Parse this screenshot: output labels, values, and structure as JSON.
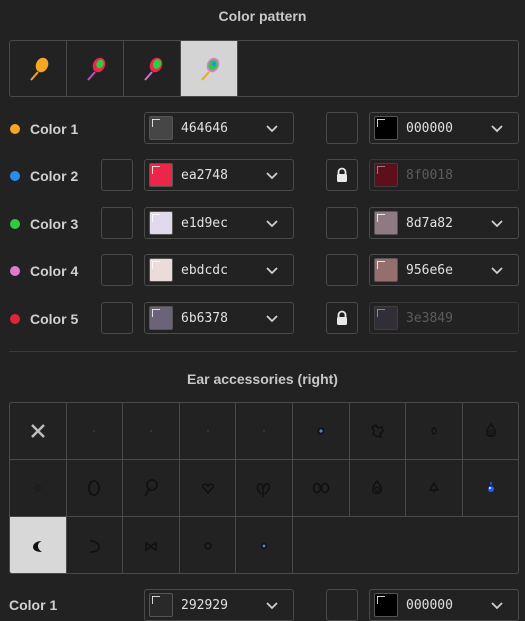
{
  "color_pattern": {
    "title": "Color pattern",
    "tiles": [
      {
        "icon": "balloon-orange-icon",
        "selected": false
      },
      {
        "icon": "balloon-red-green-icon",
        "selected": false
      },
      {
        "icon": "balloon-red-green-icon",
        "selected": false
      },
      {
        "icon": "balloon-pink-green-icon",
        "selected": true
      }
    ]
  },
  "colors": [
    {
      "label": "Color 1",
      "dot": "#f5a623",
      "primary_hex": "464646",
      "primary_color": "#464646",
      "primary_disabled": false,
      "secondary_hex": "000000",
      "secondary_color": "#000000",
      "secondary_disabled": false,
      "show_left_box": false,
      "locked": false
    },
    {
      "label": "Color 2",
      "dot": "#2a8cf0",
      "primary_hex": "ea2748",
      "primary_color": "#ea2748",
      "primary_disabled": false,
      "secondary_hex": "8f0018",
      "secondary_color": "#8f0018",
      "secondary_disabled": true,
      "show_left_box": true,
      "locked": true
    },
    {
      "label": "Color 3",
      "dot": "#2ecc40",
      "primary_hex": "e1d9ec",
      "primary_color": "#e1d9ec",
      "primary_disabled": false,
      "secondary_hex": "8d7a82",
      "secondary_color": "#8d7a82",
      "secondary_disabled": false,
      "show_left_box": true,
      "locked": false
    },
    {
      "label": "Color 4",
      "dot": "#e07ad0",
      "primary_hex": "ebdcdc",
      "primary_color": "#ebdcdc",
      "primary_disabled": false,
      "secondary_hex": "956e6e",
      "secondary_color": "#956e6e",
      "secondary_disabled": false,
      "show_left_box": true,
      "locked": false
    },
    {
      "label": "Color 5",
      "dot": "#e0243c",
      "primary_hex": "6b6378",
      "primary_color": "#6b6378",
      "primary_disabled": false,
      "secondary_hex": "3e3849",
      "secondary_color": "#3e3849",
      "secondary_disabled": true,
      "show_left_box": true,
      "locked": true
    }
  ],
  "ear_accessories": {
    "title": "Ear accessories (right)",
    "items": [
      "none-x-icon",
      "tiny-dot-icon",
      "tiny-dot-icon",
      "tiny-dot-icon",
      "tiny-dot-icon",
      "dark-gem-icon",
      "flower-icon",
      "small-ring-icon",
      "drop-ring-icon",
      "small-diamond-icon",
      "large-ring-icon",
      "loop-pendant-icon",
      "heart-icon",
      "double-heart-icon",
      "double-ring-icon",
      "drop-ring-icon",
      "spade-pendant-icon",
      "blue-gem-icon",
      "crescent-icon",
      "crescent-open-icon",
      "bow-icon",
      "tiny-ring-icon",
      "blue-stud-icon"
    ],
    "selected_index": 18
  },
  "bottom_color": {
    "label": "Color 1",
    "primary_hex": "292929",
    "primary_color": "#292929",
    "secondary_hex": "000000",
    "secondary_color": "#000000"
  }
}
